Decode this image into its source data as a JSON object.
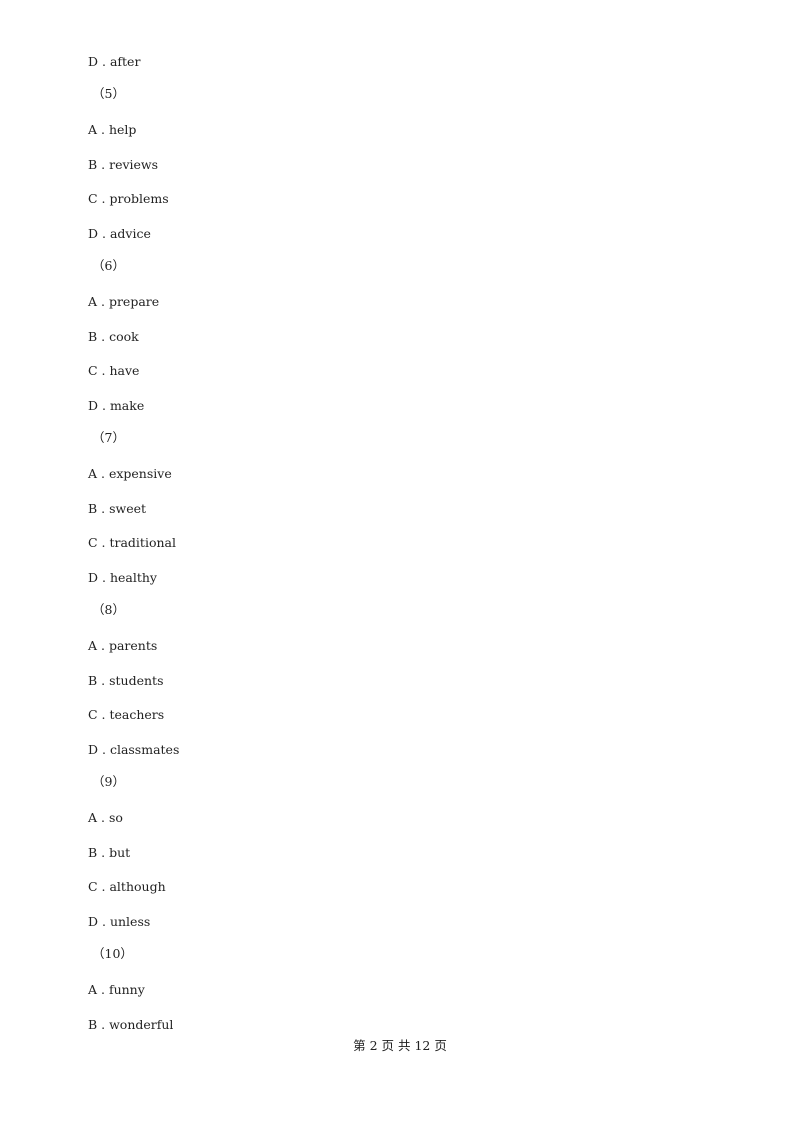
{
  "content": [
    {
      "type": "option",
      "text": "D . after"
    },
    {
      "type": "question",
      "text": "（5）"
    },
    {
      "type": "option",
      "text": "A . help"
    },
    {
      "type": "option",
      "text": "B . reviews"
    },
    {
      "type": "option",
      "text": "C . problems"
    },
    {
      "type": "option",
      "text": "D . advice"
    },
    {
      "type": "question",
      "text": "（6）"
    },
    {
      "type": "option",
      "text": "A . prepare"
    },
    {
      "type": "option",
      "text": "B . cook"
    },
    {
      "type": "option",
      "text": "C . have"
    },
    {
      "type": "option",
      "text": "D . make"
    },
    {
      "type": "question",
      "text": "（7）"
    },
    {
      "type": "option",
      "text": "A . expensive"
    },
    {
      "type": "option",
      "text": "B . sweet"
    },
    {
      "type": "option",
      "text": "C . traditional"
    },
    {
      "type": "option",
      "text": "D . healthy"
    },
    {
      "type": "question",
      "text": "（8）"
    },
    {
      "type": "option",
      "text": "A . parents"
    },
    {
      "type": "option",
      "text": "B . students"
    },
    {
      "type": "option",
      "text": "C . teachers"
    },
    {
      "type": "option",
      "text": "D . classmates"
    },
    {
      "type": "question",
      "text": "（9）"
    },
    {
      "type": "option",
      "text": "A . so"
    },
    {
      "type": "option",
      "text": "B . but"
    },
    {
      "type": "option",
      "text": "C . although"
    },
    {
      "type": "option",
      "text": "D . unless"
    },
    {
      "type": "question",
      "text": "（10）"
    },
    {
      "type": "option",
      "text": "A . funny"
    },
    {
      "type": "option",
      "text": "B . wonderful"
    }
  ],
  "footer": {
    "text": "第 2 页 共 12 页"
  }
}
